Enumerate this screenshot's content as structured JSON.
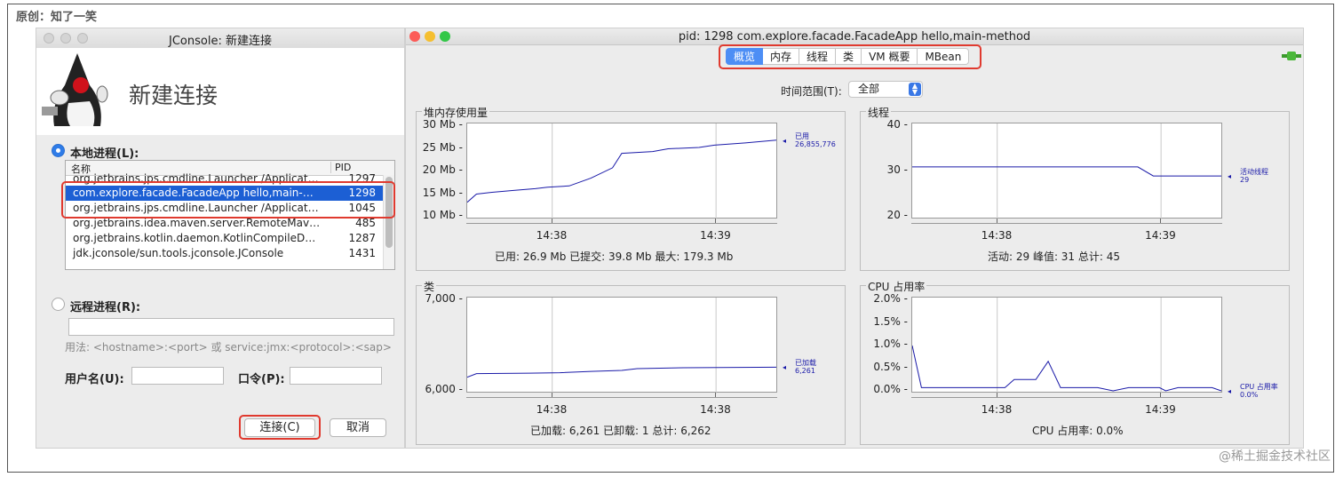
{
  "caption": "原创：知了一笑",
  "watermark": "@稀土掘金技术社区",
  "connect_dialog": {
    "title": "JConsole: 新建连接",
    "banner_title": "新建连接",
    "local_label": "本地进程(L):",
    "columns": {
      "name": "名称",
      "pid": "PID"
    },
    "processes": [
      {
        "name": "org.jetbrains.jps.cmdline.Launcher /Applicat…",
        "pid": "1297"
      },
      {
        "name": "com.explore.facade.FacadeApp hello,main-…",
        "pid": "1298"
      },
      {
        "name": "org.jetbrains.jps.cmdline.Launcher /Applicat…",
        "pid": "1045"
      },
      {
        "name": "org.jetbrains.idea.maven.server.RemoteMav…",
        "pid": "485"
      },
      {
        "name": "org.jetbrains.kotlin.daemon.KotlinCompileD…",
        "pid": "1287"
      },
      {
        "name": "jdk.jconsole/sun.tools.jconsole.JConsole",
        "pid": "1431"
      }
    ],
    "selected_pid": "1298",
    "remote_label": "远程进程(R):",
    "remote_value": "",
    "usage_hint": "用法: <hostname>:<port> 或 service:jmx:<protocol>:<sap>",
    "username_label": "用户名(U):",
    "username_value": "",
    "password_label": "口令(P):",
    "password_value": "",
    "connect_label": "连接(C)",
    "cancel_label": "取消"
  },
  "monitor": {
    "title": "pid: 1298 com.explore.facade.FacadeApp hello,main-method",
    "tabs": [
      "概览",
      "内存",
      "线程",
      "类",
      "VM 概要",
      "MBean"
    ],
    "active_tab": "概览",
    "time_range_label": "时间范围(T):",
    "time_range_value": "全部",
    "accent": "#4d8ef5"
  },
  "chart_data": [
    {
      "type": "line",
      "title": "堆内存使用量",
      "yticks": [
        "30 Mb",
        "25 Mb",
        "20 Mb",
        "15 Mb",
        "10 Mb"
      ],
      "ylim": [
        10,
        30
      ],
      "xticks": [
        "14:38",
        "14:39"
      ],
      "xtick_pos": [
        0.275,
        0.805
      ],
      "series": [
        {
          "name": "已用",
          "last_value": "26,855,776",
          "points": [
            [
              0,
              13.2
            ],
            [
              0.03,
              15
            ],
            [
              0.08,
              15.4
            ],
            [
              0.15,
              15.8
            ],
            [
              0.22,
              16.2
            ],
            [
              0.26,
              16.5
            ],
            [
              0.33,
              16.8
            ],
            [
              0.4,
              18.5
            ],
            [
              0.47,
              20.8
            ],
            [
              0.5,
              24
            ],
            [
              0.6,
              24.4
            ],
            [
              0.65,
              25
            ],
            [
              0.75,
              25.3
            ],
            [
              0.8,
              25.8
            ],
            [
              0.9,
              26.3
            ],
            [
              1,
              26.9
            ]
          ]
        }
      ],
      "stats": "已用: 26.9 Mb    已提交: 39.8 Mb    最大: 179.3 Mb"
    },
    {
      "type": "line",
      "title": "线程",
      "yticks": [
        "40",
        "30",
        "20"
      ],
      "ylim": [
        20,
        40
      ],
      "xticks": [
        "14:38",
        "14:39"
      ],
      "xtick_pos": [
        0.275,
        0.805
      ],
      "series": [
        {
          "name": "活动线程",
          "last_value": "29",
          "points": [
            [
              0,
              31
            ],
            [
              0.73,
              31
            ],
            [
              0.78,
              29
            ],
            [
              1,
              29
            ]
          ]
        }
      ],
      "stats": "活动: 29    峰值: 31    总计: 45"
    },
    {
      "type": "line",
      "title": "类",
      "yticks": [
        "7,000",
        "6,000"
      ],
      "ylim": [
        6000,
        7000
      ],
      "xticks": [
        "14:38",
        "14:38"
      ],
      "xtick_pos": [
        0.275,
        0.805
      ],
      "series": [
        {
          "name": "已加载",
          "last_value": "6,261",
          "points": [
            [
              0,
              6150
            ],
            [
              0.03,
              6190
            ],
            [
              0.2,
              6195
            ],
            [
              0.3,
              6200
            ],
            [
              0.4,
              6215
            ],
            [
              0.5,
              6225
            ],
            [
              0.55,
              6245
            ],
            [
              0.7,
              6255
            ],
            [
              1,
              6261
            ]
          ]
        }
      ],
      "stats": "已加载: 6,261    已卸载: 1    总计: 6,262"
    },
    {
      "type": "line",
      "title": "CPU 占用率",
      "yticks": [
        "2.0%",
        "1.5%",
        "1.0%",
        "0.5%",
        "0.0%"
      ],
      "ylim": [
        0,
        2
      ],
      "xticks": [
        "14:38",
        "14:39"
      ],
      "xtick_pos": [
        0.275,
        0.805
      ],
      "series": [
        {
          "name": "CPU 占用率",
          "last_value": "0.0%",
          "points": [
            [
              0,
              1
            ],
            [
              0.03,
              0.07
            ],
            [
              0.1,
              0.07
            ],
            [
              0.3,
              0.07
            ],
            [
              0.33,
              0.25
            ],
            [
              0.4,
              0.25
            ],
            [
              0.44,
              0.65
            ],
            [
              0.48,
              0.07
            ],
            [
              0.6,
              0.07
            ],
            [
              0.65,
              0
            ],
            [
              0.7,
              0.07
            ],
            [
              0.8,
              0.07
            ],
            [
              0.82,
              0
            ],
            [
              0.86,
              0.07
            ],
            [
              0.97,
              0.07
            ],
            [
              1,
              0
            ]
          ]
        }
      ],
      "stats": "CPU 占用率: 0.0%"
    }
  ]
}
